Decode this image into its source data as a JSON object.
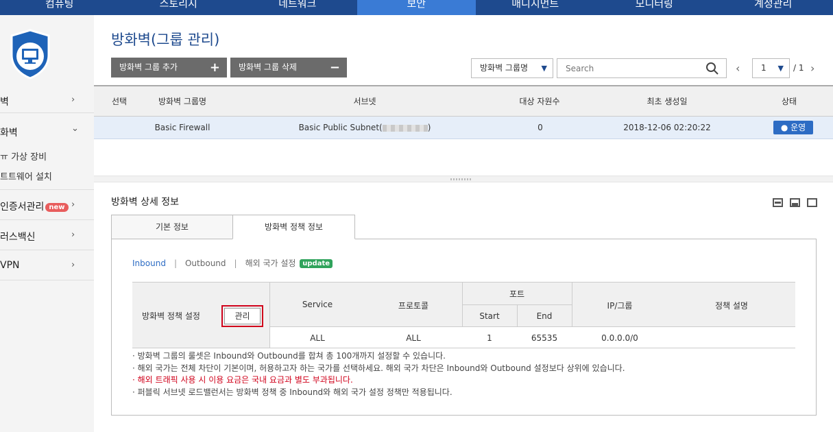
{
  "topnav": {
    "items": [
      "컴퓨팅",
      "스토리지",
      "네트워크",
      "보안",
      "매니지먼트",
      "모니터링",
      "계정관리"
    ],
    "active_index": 3
  },
  "sidebar": {
    "items": [
      {
        "label": "벽",
        "chevron": "›"
      },
      {
        "label": "화벽",
        "chevron": "⌄"
      },
      {
        "label": "인증서관리",
        "badge": "new",
        "chevron": "›"
      },
      {
        "label": "러스백신",
        "chevron": "›"
      },
      {
        "label": "VPN",
        "chevron": "›"
      }
    ],
    "sub_items": [
      "ㅠ 가상 장비",
      "트트웨어 설치"
    ]
  },
  "page": {
    "title": "방화벽(그룹 관리)",
    "add_button": "방화벽 그룹 추가",
    "delete_button": "방화벽 그룹 삭제",
    "filter_value": "방화벽 그룹명",
    "search_placeholder": "Search",
    "page_current": "1",
    "page_total": "/ 1",
    "prev": "‹",
    "next": "›"
  },
  "group_table": {
    "headers": [
      "선택",
      "방화벽 그룹명",
      "서브넷",
      "대상 자원수",
      "최초 생성일",
      "상태"
    ],
    "rows": [
      {
        "name": "Basic Firewall",
        "subnet_prefix": "Basic Public Subnet(",
        "subnet_suffix": ")",
        "resources": "0",
        "created": "2018-12-06 02:20:22",
        "status": "● 운영"
      }
    ]
  },
  "detail": {
    "title": "방화벽 상세 정보",
    "tabs": [
      "기본 정보",
      "방화벽 정책 정보"
    ],
    "active_tab": 1,
    "subtabs": [
      "Inbound",
      "Outbound",
      "해외 국가 설정"
    ],
    "subtab_sep": "|",
    "update_badge": "update",
    "policy": {
      "setting_label": "방화벽 정책 설정",
      "manage_button": "관리",
      "headers": {
        "service": "Service",
        "protocol": "프로토콜",
        "port": "포트",
        "start": "Start",
        "end": "End",
        "ip_group": "IP/그룹",
        "description": "정책 설명"
      },
      "rows": [
        {
          "service": "ALL",
          "protocol": "ALL",
          "start": "1",
          "end": "65535",
          "ip": "0.0.0.0/0",
          "description": ""
        }
      ]
    },
    "notes": [
      "· 방화벽 그룹의 룰셋은 Inbound와 Outbound를 합쳐 총 100개까지 설정할 수 있습니다.",
      "· 해외 국가는 전체 차단이 기본이며, 허용하고자 하는 국가를 선택하세요. 해외 국가 차단은 Inbound와 Outbound 설정보다 상위에 있습니다.",
      "· 해외 트래픽 사용 시 이용 요금은 국내 요금과 별도 부과됩니다.",
      "· 퍼블릭 서브넷 로드밸런서는 방화벽 정책 중 Inbound와 해외 국가 설정 정책만 적용됩니다."
    ]
  },
  "colors": {
    "nav": "#1e4a8e",
    "nav_active": "#3a7bd5",
    "status": "#2d6cc4",
    "highlight": "#d0021b"
  }
}
